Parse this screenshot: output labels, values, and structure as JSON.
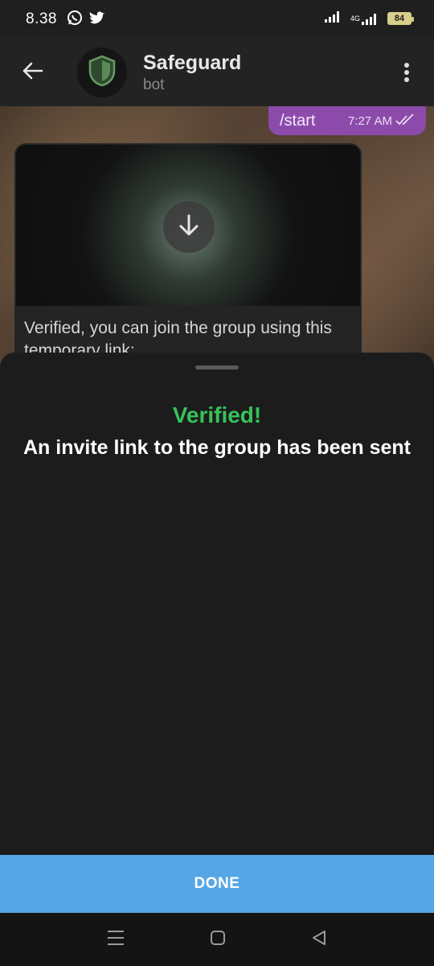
{
  "status_bar": {
    "time": "8.38",
    "left_icons": [
      "whatsapp-icon",
      "twitter-icon"
    ],
    "network": "4G",
    "battery": "84"
  },
  "header": {
    "title": "Safeguard",
    "subtitle": "bot"
  },
  "chat": {
    "outgoing": {
      "text": "/start",
      "time": "7:27 AM"
    },
    "incoming": {
      "text": "Verified, you can join the group using this temporary link:"
    }
  },
  "sheet": {
    "title": "Verified!",
    "message": "An invite link to the group has been sent",
    "button_label": "DONE"
  },
  "colors": {
    "accent_green": "#36c25a",
    "done_button": "#55a6e6",
    "outgoing_bubble": "#8c4bab"
  }
}
